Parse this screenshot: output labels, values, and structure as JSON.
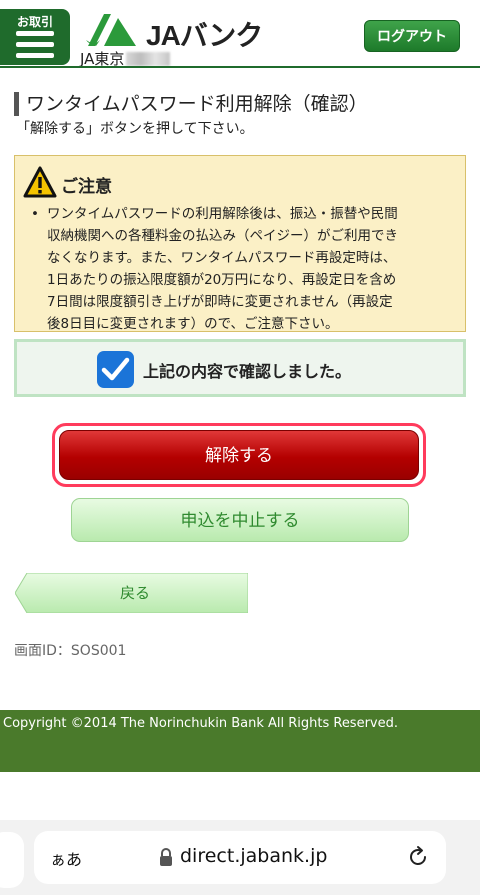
{
  "header": {
    "menu_label": "お取引",
    "logo_text": "JAバンク",
    "branch": "JA東京",
    "logout_label": "ログアウト",
    "brand_color": "#1f6b2c"
  },
  "page": {
    "title": "ワンタイムパスワード利用解除（確認）",
    "subtitle": "「解除する」ボタンを押して下さい。"
  },
  "caution": {
    "title": "ご注意",
    "lines": [
      "ワンタイムパスワードの利用解除後は、振込・振替や民間",
      "収納機関への各種料金の払込み（ペイジー）がご利用でき",
      "なくなります。また、ワンタイムパスワード再設定時は、",
      "1日あたりの振込限度額が20万円になり、再設定日を含め",
      "7日間は限度額引き上げが即時に変更されません（再設定",
      "後8日目に変更されます）ので、ご注意下さい。"
    ]
  },
  "confirm": {
    "label": "上記の内容で確認しました。",
    "checked": true
  },
  "buttons": {
    "release": "解除する",
    "abort": "申込を中止する",
    "back": "戻る"
  },
  "screen_id": "画面ID：SOS001",
  "footer": {
    "copyright": "Copyright ©2014 The Norinchukin Bank All Rights Reserved."
  },
  "browser": {
    "aa_label": "ぁあ",
    "url": "direct.jabank.jp"
  }
}
